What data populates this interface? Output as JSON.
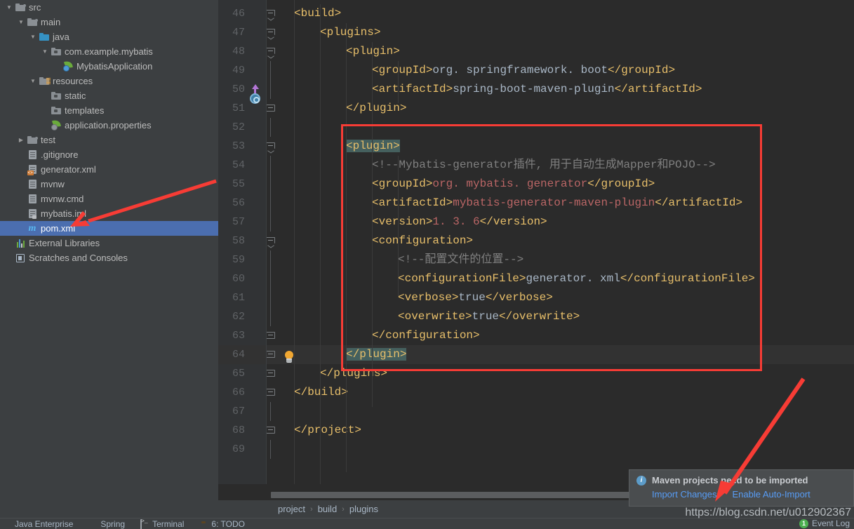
{
  "sidebar": {
    "items": [
      {
        "label": "src",
        "indent": 0,
        "arrow": "down",
        "icon": "folder-src"
      },
      {
        "label": "main",
        "indent": 1,
        "arrow": "down",
        "icon": "folder-src"
      },
      {
        "label": "java",
        "indent": 2,
        "arrow": "down",
        "icon": "folder-blue"
      },
      {
        "label": "com.example.mybatis",
        "indent": 3,
        "arrow": "down",
        "icon": "folder-package"
      },
      {
        "label": "MybatisApplication",
        "indent": 4,
        "arrow": "none",
        "icon": "spring-class-icon"
      },
      {
        "label": "resources",
        "indent": 2,
        "arrow": "down",
        "icon": "folder-resources"
      },
      {
        "label": "static",
        "indent": 3,
        "arrow": "none",
        "icon": "folder-package"
      },
      {
        "label": "templates",
        "indent": 3,
        "arrow": "none",
        "icon": "folder-package"
      },
      {
        "label": "application.properties",
        "indent": 3,
        "arrow": "none",
        "icon": "spring-properties-icon"
      },
      {
        "label": "test",
        "indent": 1,
        "arrow": "right",
        "icon": "folder-src"
      },
      {
        "label": ".gitignore",
        "indent": 1,
        "arrow": "none",
        "icon": "file-icon"
      },
      {
        "label": "generator.xml",
        "indent": 1,
        "arrow": "none",
        "icon": "file-xml-icon"
      },
      {
        "label": "mvnw",
        "indent": 1,
        "arrow": "none",
        "icon": "file-icon"
      },
      {
        "label": "mvnw.cmd",
        "indent": 1,
        "arrow": "none",
        "icon": "file-icon"
      },
      {
        "label": "mybatis.iml",
        "indent": 1,
        "arrow": "none",
        "icon": "file-iml-icon"
      },
      {
        "label": "pom.xml",
        "indent": 1,
        "arrow": "none",
        "icon": "maven-m-icon",
        "selected": true
      },
      {
        "label": "External Libraries",
        "indent": 0,
        "arrow": "none",
        "icon": "libraries-icon"
      },
      {
        "label": "Scratches and Consoles",
        "indent": 0,
        "arrow": "none",
        "icon": "scratches-icon"
      }
    ]
  },
  "editor": {
    "lines": [
      {
        "num": "46",
        "indent": 0,
        "fold": "tip",
        "segs": [
          {
            "t": "<build>",
            "c": "tag"
          }
        ]
      },
      {
        "num": "47",
        "indent": 1,
        "fold": "tip",
        "segs": [
          {
            "t": "<plugins>",
            "c": "tag"
          }
        ]
      },
      {
        "num": "48",
        "indent": 2,
        "fold": "tip",
        "segs": [
          {
            "t": "<plugin>",
            "c": "tag"
          }
        ]
      },
      {
        "num": "49",
        "indent": 3,
        "fold": "",
        "segs": [
          {
            "t": "<groupId>",
            "c": "tag"
          },
          {
            "t": "org. springframework. boot",
            "c": "val"
          },
          {
            "t": "</groupId>",
            "c": "tag"
          }
        ]
      },
      {
        "num": "50",
        "indent": 3,
        "fold": "",
        "segs": [
          {
            "t": "<artifactId>",
            "c": "tag"
          },
          {
            "t": "spring-boot-maven-plugin",
            "c": "val"
          },
          {
            "t": "</artifactId>",
            "c": "tag"
          }
        ]
      },
      {
        "num": "51",
        "indent": 2,
        "fold": "end",
        "segs": [
          {
            "t": "</plugin>",
            "c": "tag"
          }
        ]
      },
      {
        "num": "52",
        "indent": 2,
        "fold": "",
        "segs": []
      },
      {
        "num": "53",
        "indent": 2,
        "fold": "tip",
        "segs": [
          {
            "t": "<plugin>",
            "c": "tag hl"
          }
        ]
      },
      {
        "num": "54",
        "indent": 3,
        "fold": "",
        "segs": [
          {
            "t": "<!--Mybatis-generator插件, 用于自动生成Mapper和POJO-->",
            "c": "cmt"
          }
        ]
      },
      {
        "num": "55",
        "indent": 3,
        "fold": "",
        "segs": [
          {
            "t": "<groupId>",
            "c": "tag"
          },
          {
            "t": "org. mybatis. generator",
            "c": "valr"
          },
          {
            "t": "</groupId>",
            "c": "tag"
          }
        ]
      },
      {
        "num": "56",
        "indent": 3,
        "fold": "",
        "segs": [
          {
            "t": "<artifactId>",
            "c": "tag"
          },
          {
            "t": "mybatis-generator-maven-plugin",
            "c": "valr"
          },
          {
            "t": "</artifactId>",
            "c": "tag"
          }
        ]
      },
      {
        "num": "57",
        "indent": 3,
        "fold": "",
        "segs": [
          {
            "t": "<version>",
            "c": "tag"
          },
          {
            "t": "1. 3. 6",
            "c": "valr"
          },
          {
            "t": "</version>",
            "c": "tag"
          }
        ]
      },
      {
        "num": "58",
        "indent": 3,
        "fold": "tip",
        "segs": [
          {
            "t": "<configuration>",
            "c": "tag"
          }
        ]
      },
      {
        "num": "59",
        "indent": 4,
        "fold": "",
        "segs": [
          {
            "t": "<!--配置文件的位置-->",
            "c": "cmt"
          }
        ]
      },
      {
        "num": "60",
        "indent": 4,
        "fold": "",
        "segs": [
          {
            "t": "<configurationFile>",
            "c": "tag"
          },
          {
            "t": "generator. xml",
            "c": "val"
          },
          {
            "t": "</configurationFile>",
            "c": "tag"
          }
        ]
      },
      {
        "num": "61",
        "indent": 4,
        "fold": "",
        "segs": [
          {
            "t": "<verbose>",
            "c": "tag"
          },
          {
            "t": "true",
            "c": "val"
          },
          {
            "t": "</verbose>",
            "c": "tag"
          }
        ]
      },
      {
        "num": "62",
        "indent": 4,
        "fold": "",
        "segs": [
          {
            "t": "<overwrite>",
            "c": "tag"
          },
          {
            "t": "true",
            "c": "val"
          },
          {
            "t": "</overwrite>",
            "c": "tag"
          }
        ]
      },
      {
        "num": "63",
        "indent": 3,
        "fold": "end",
        "segs": [
          {
            "t": "</configuration>",
            "c": "tag"
          }
        ]
      },
      {
        "num": "64",
        "indent": 2,
        "fold": "end",
        "segs": [
          {
            "t": "</plugin>",
            "c": "tag hl"
          }
        ],
        "current": true,
        "bulb": true
      },
      {
        "num": "65",
        "indent": 1,
        "fold": "end",
        "segs": [
          {
            "t": "</plugins>",
            "c": "tag"
          }
        ]
      },
      {
        "num": "66",
        "indent": 0,
        "fold": "end",
        "segs": [
          {
            "t": "</build>",
            "c": "tag"
          }
        ]
      },
      {
        "num": "67",
        "indent": 0,
        "fold": "",
        "segs": []
      },
      {
        "num": "68",
        "indent": -1,
        "fold": "end",
        "segs": [
          {
            "t": "</project>",
            "c": "tag"
          }
        ]
      },
      {
        "num": "69",
        "indent": -1,
        "fold": "",
        "segs": []
      }
    ]
  },
  "breadcrumb": {
    "crumbs": [
      "project",
      "build",
      "plugins"
    ],
    "separator": "›"
  },
  "notification": {
    "title": "Maven projects need to be imported",
    "import_changes": "Import Changes",
    "enable_auto_import": "Enable Auto-Import"
  },
  "bottom_bar": {
    "items": [
      {
        "label": "Java Enterprise",
        "icon": "java-enterprise-icon"
      },
      {
        "label": "Spring",
        "icon": "spring-leaf-icon"
      },
      {
        "label": "Terminal",
        "icon": "terminal-icon"
      },
      {
        "label": "6: TODO",
        "icon": "todo-icon"
      }
    ],
    "event_log": "Event Log",
    "event_count": "1"
  },
  "watermark": "https://blog.csdn.net/u012902367",
  "colors": {
    "accent_red": "#f73c35",
    "selection_blue": "#4b6eaf",
    "tag_yellow": "#e8bf6a",
    "value_red": "#bb6666",
    "link_blue": "#589df6"
  }
}
